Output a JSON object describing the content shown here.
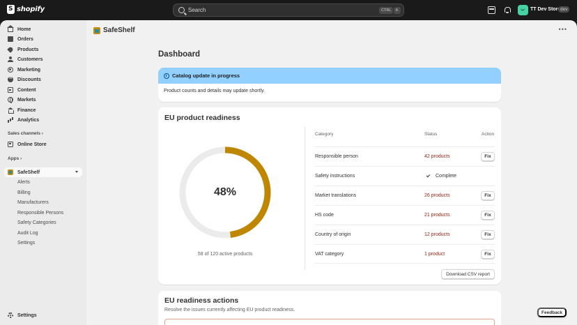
{
  "topbar": {
    "brand": "shopify",
    "search_placeholder": "Search",
    "kbd_ctrl": "CTRL",
    "kbd_k": "K",
    "store_name": "TT Dev Store",
    "store_badge": "dev"
  },
  "sidebar": {
    "items": [
      {
        "label": "Home",
        "icon": "home-icon"
      },
      {
        "label": "Orders",
        "icon": "orders-icon"
      },
      {
        "label": "Products",
        "icon": "tag-icon"
      },
      {
        "label": "Customers",
        "icon": "person-icon"
      },
      {
        "label": "Marketing",
        "icon": "target-icon"
      },
      {
        "label": "Discounts",
        "icon": "discount-icon"
      },
      {
        "label": "Content",
        "icon": "content-icon"
      },
      {
        "label": "Markets",
        "icon": "globe-icon"
      },
      {
        "label": "Finance",
        "icon": "bank-icon"
      },
      {
        "label": "Analytics",
        "icon": "chart-icon"
      }
    ],
    "sales_channels_label": "Sales channels",
    "online_store": "Online Store",
    "apps_label": "Apps",
    "app_name": "SafeShelf",
    "app_subitems": [
      "Alerts",
      "Billing",
      "Manufacturers",
      "Responsible Persons",
      "Safety Categories",
      "Audit Log",
      "Settings"
    ],
    "settings": "Settings"
  },
  "main": {
    "app_title": "SafeShelf",
    "page_title": "Dashboard",
    "banner": {
      "title": "Catalog update in progress",
      "body": "Product counts and details may update shortly."
    },
    "readiness": {
      "title": "EU product readiness",
      "percent_label": "48%",
      "percent_value": 48,
      "caption": "58 of 120 active products",
      "columns": {
        "category": "Category",
        "status": "Status",
        "action": "Action"
      },
      "rows": [
        {
          "category": "Responsible person",
          "status": "42 products",
          "action": "Fix"
        },
        {
          "category": "Safety instructions",
          "status": "Complete",
          "action": ""
        },
        {
          "category": "Market translations",
          "status": "26 products",
          "action": "Fix"
        },
        {
          "category": "HS code",
          "status": "21 products",
          "action": "Fix"
        },
        {
          "category": "Country of origin",
          "status": "12 products",
          "action": "Fix"
        },
        {
          "category": "VAT category",
          "status": "1 product",
          "action": "Fix"
        }
      ],
      "csv_button": "Download CSV report"
    },
    "actions": {
      "title": "EU readiness actions",
      "subtitle": "Resolve the issues currently affecting EU product readiness."
    },
    "feedback": "Feedback"
  },
  "colors": {
    "donut_fill": "#bf8700",
    "donut_track": "#ebebeb",
    "banner_bg": "#91d0ff",
    "critical_text": "#8e1f0b"
  }
}
